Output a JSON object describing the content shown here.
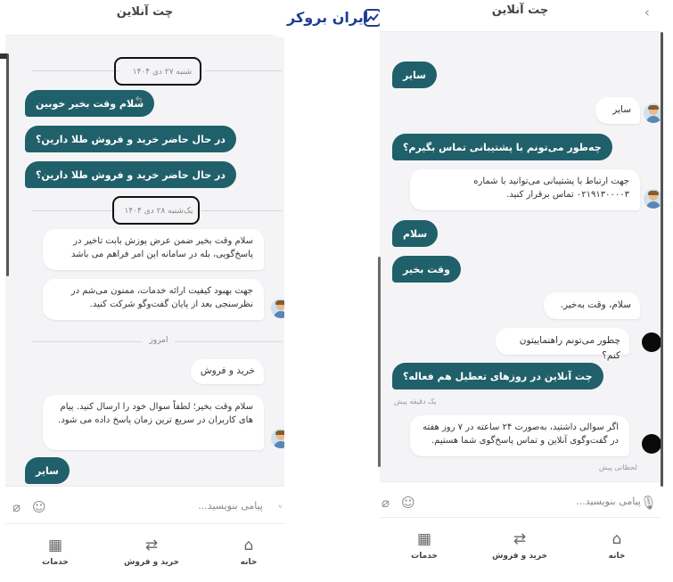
{
  "brand": {
    "logo_text": "ایران بروکر"
  },
  "left": {
    "title": "چت آنلاین",
    "date1": "شنبه ۲۷ دی ۱۴۰۴",
    "msg_out1": "سلام وقت بخیر خوبین",
    "msg_out2": "در حال حاضر خرید و فروش طلا دارین؟",
    "msg_out3": "در حال حاضر خرید و فروش طلا دارین؟",
    "date2": "یک‌شنبه ۲۸ دی ۱۴۰۴",
    "msg_in1": "سلام وقت بخیر ضمن عرض پوزش بابت تاخیر در پاسخ‌گویی، بله در سامانه این امر فراهم می باشد",
    "msg_in2": "جهت بهبود کیفیت ارائه خدمات، ممنون می‌شم در نظرسنجی بعد از پایان گفت‌وگو شرکت کنید.",
    "today": "امروز",
    "msg_in3": "خرید و فروش",
    "msg_in4": "سلام وقت بخیر؛ لطفاً سوال خود را ارسال کنید. پیام های کاربران در سریع ترین زمان پاسخ داده می شود.",
    "msg_out4": "سایر",
    "composer_placeholder": "پیامی بنویسید...",
    "nav": [
      {
        "label": "خانه",
        "icon": "home-icon"
      },
      {
        "label": "خرید و فروش",
        "icon": "swap-icon"
      },
      {
        "label": "خدمات",
        "icon": "grid-icon"
      }
    ]
  },
  "right": {
    "title": "چت آنلاین",
    "msg_out1": "سایر",
    "msg_in1": "سایر",
    "msg_out2": "چه‌طور می‌تونم با پشتیبانی تماس بگیرم؟",
    "msg_in2": "جهت ارتباط با پشتیبانی می‌توانید با شماره ۰۲۱۹۱۳۰۰۰۰۳ تماس برقرار کنید.",
    "msg_out3": "سلام",
    "msg_out4": "وقت بخیر",
    "msg_in3": "سلام، وقت به‌خیر.",
    "msg_in4": "چطور می‌تونم راهنماییتون کنم؟",
    "msg_out5": "چت آنلاین در روزهای تعطیل هم فعاله؟",
    "meta1": "یک دقیقه پیش",
    "msg_in5": "اگر سوالی داشتید، به‌صورت ۲۴ ساعته در ۷ روز هفته در گفت‌وگوی آنلاین و تماس پاسخ‌گوی شما هستیم.",
    "meta2": "لحظاتی پیش",
    "composer_placeholder": "پیامی بنویسید...",
    "nav": [
      {
        "label": "خانه",
        "icon": "home-icon"
      },
      {
        "label": "خرید و فروش",
        "icon": "swap-icon"
      },
      {
        "label": "خدمات",
        "icon": "grid-icon"
      }
    ]
  },
  "colors": {
    "accent": "#20606a",
    "brand": "#1f3e91",
    "background": "#f4f4f6"
  }
}
